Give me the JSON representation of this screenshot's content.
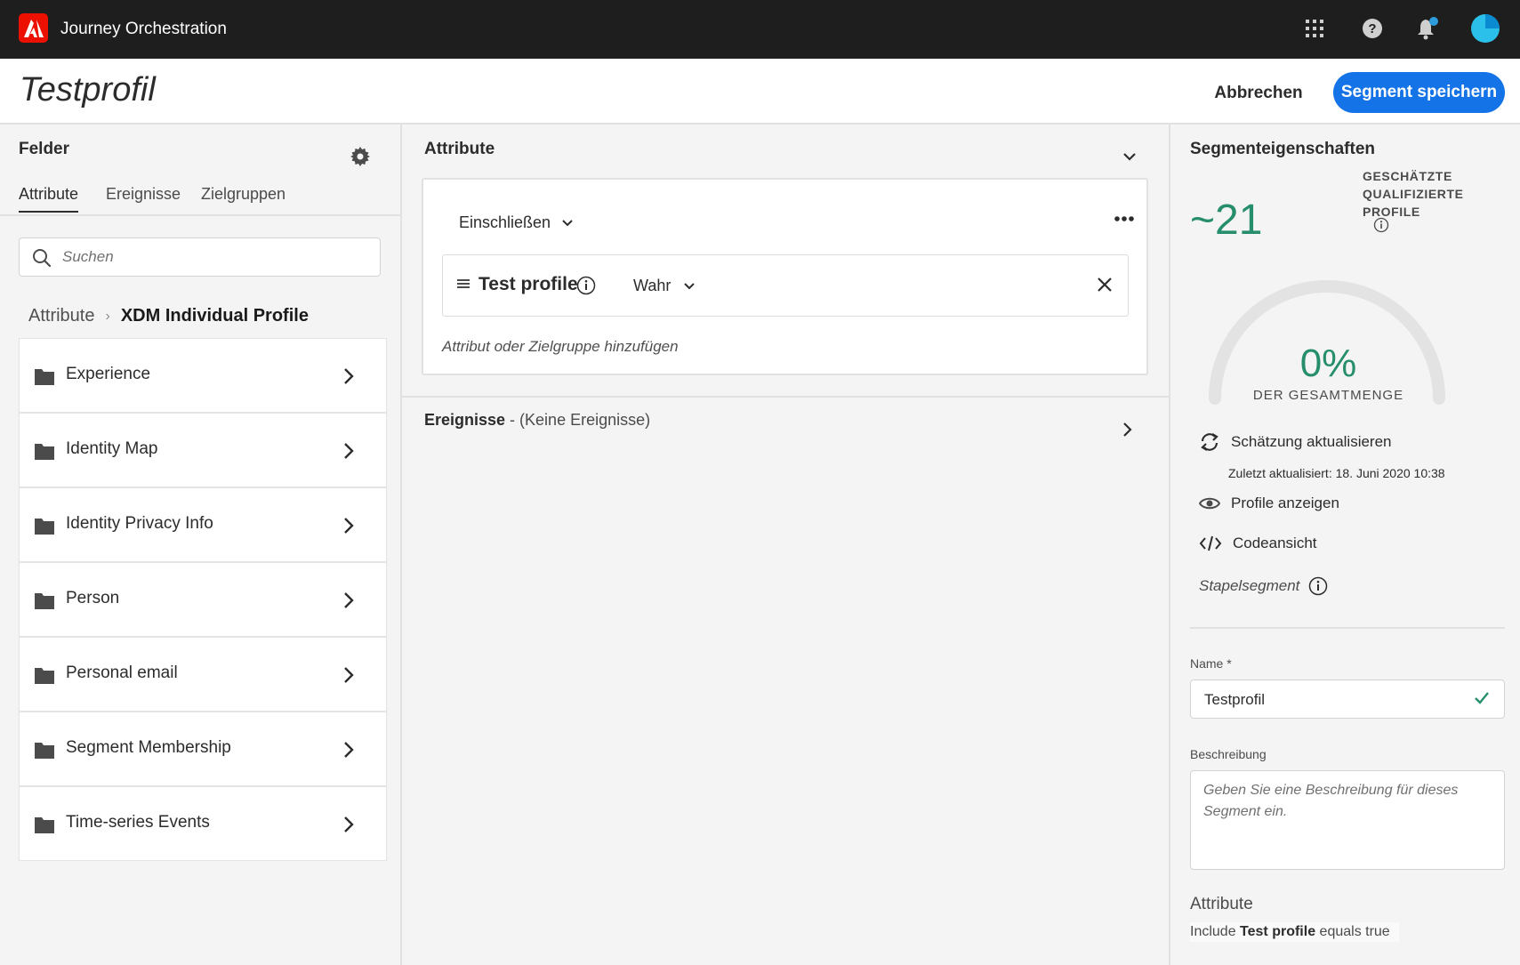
{
  "app": {
    "title": "Journey Orchestration"
  },
  "header": {
    "title": "Testprofil",
    "cancel_label": "Abbrechen",
    "save_label": "Segment speichern"
  },
  "fields_panel": {
    "heading": "Felder",
    "tabs": [
      {
        "label": "Attribute",
        "active": true
      },
      {
        "label": "Ereignisse",
        "active": false
      },
      {
        "label": "Zielgruppen",
        "active": false
      }
    ],
    "search_placeholder": "Suchen",
    "breadcrumb": {
      "parent": "Attribute",
      "current": "XDM Individual Profile"
    },
    "items": [
      {
        "label": "Experience"
      },
      {
        "label": "Identity Map"
      },
      {
        "label": "Identity Privacy Info"
      },
      {
        "label": "Person"
      },
      {
        "label": "Personal email"
      },
      {
        "label": "Segment Membership"
      },
      {
        "label": "Time-series Events"
      }
    ]
  },
  "canvas": {
    "attributes_heading": "Attribute",
    "include_label": "Einschließen",
    "rule": {
      "field": "Test profile",
      "value": "Wahr"
    },
    "add_hint": "Attribut oder Zielgruppe hinzufügen",
    "events_heading": "Ereignisse",
    "events_note": " - (Keine Ereignisse)"
  },
  "properties": {
    "heading": "Segmenteigenschaften",
    "estimate": "~21",
    "estimate_label": "GESCHÄTZTE QUALIFIZIERTE PROFILE",
    "gauge_percent": "0%",
    "gauge_label": "DER GESAMTMENGE",
    "refresh_label": "Schätzung aktualisieren",
    "last_updated": "Zuletzt aktualisiert: 18. Juni 2020 10:38",
    "view_profiles_label": "Profile anzeigen",
    "code_view_label": "Codeansicht",
    "batch_label": "Stapelsegment",
    "name_label": "Name *",
    "name_value": "Testprofil",
    "description_label": "Beschreibung",
    "description_placeholder": "Geben Sie eine Beschreibung für dieses Segment ein.",
    "summary_heading": "Attribute",
    "summary_prefix": "Include ",
    "summary_field": "Test profile",
    "summary_suffix": " equals true"
  },
  "colors": {
    "accent": "#1473e6",
    "success": "#268e6c",
    "topbar": "#1e1e1e",
    "brand": "#eb1000"
  }
}
